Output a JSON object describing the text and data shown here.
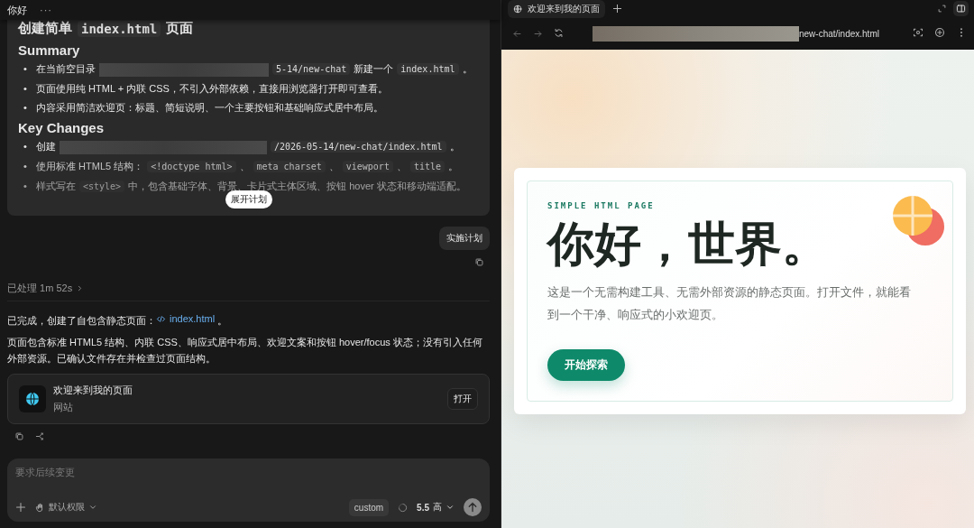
{
  "chat": {
    "title": "你好",
    "menu": "···",
    "plan": {
      "heading": [
        {
          "kind": "text",
          "text": "创建简单"
        },
        {
          "kind": "code",
          "text": "index.html"
        },
        {
          "kind": "text",
          "text": "页面"
        }
      ],
      "marker": "•",
      "sections": [
        {
          "title": "Summary",
          "bullets": [
            [
              {
                "kind": "text",
                "text": "在当前空目录"
              },
              {
                "kind": "redacted"
              },
              {
                "kind": "code",
                "text": "5-14/new-chat"
              },
              {
                "kind": "text",
                "text": "新建一个"
              },
              {
                "kind": "code",
                "text": "index.html"
              },
              {
                "kind": "text",
                "text": "。"
              }
            ],
            [
              {
                "kind": "text",
                "text": "页面使用纯 HTML + 内联 CSS，不引入外部依赖，直接用浏览器打开即可查看。"
              }
            ],
            [
              {
                "kind": "text",
                "text": "内容采用简洁欢迎页：标题、简短说明、一个主要按钮和基础响应式居中布局。"
              }
            ]
          ]
        },
        {
          "title": "Key Changes",
          "bullets": [
            [
              {
                "kind": "text",
                "text": "创建"
              },
              {
                "kind": "redacted"
              },
              {
                "kind": "code",
                "text": "/2026-05-14/new-chat/index.html"
              },
              {
                "kind": "text",
                "text": "。"
              }
            ],
            [
              {
                "kind": "text",
                "text": "使用标准 HTML5 结构："
              },
              {
                "kind": "code",
                "text": "<!doctype html>"
              },
              {
                "kind": "text",
                "text": "、"
              },
              {
                "kind": "code",
                "text": "meta charset"
              },
              {
                "kind": "text",
                "text": "、"
              },
              {
                "kind": "code",
                "text": "viewport"
              },
              {
                "kind": "text",
                "text": "、"
              },
              {
                "kind": "code",
                "text": "title"
              },
              {
                "kind": "text",
                "text": "。"
              }
            ],
            [
              {
                "kind": "text",
                "text": "样式写在"
              },
              {
                "kind": "code",
                "text": "<style>"
              },
              {
                "kind": "text",
                "text": "中，包含基础字体、背景、卡片式主体区域、按钮 hover 状态和移动端适配。"
              }
            ]
          ]
        }
      ],
      "expand_button": "展开计划"
    },
    "user_message": "实施计划",
    "processed": "已处理 1m 52s",
    "reply": {
      "lead": "已完成，创建了自包含静态页面：",
      "link": "index.html",
      "tail": "。",
      "body": "页面包含标准 HTML5 结构、内联 CSS、响应式居中布局、欢迎文案和按钮 hover/focus 状态；没有引入任何外部资源。已确认文件存在并检查过页面结构。"
    },
    "attachment": {
      "title": "欢迎来到我的页面",
      "subtitle": "网站",
      "button": "打开"
    },
    "composer": {
      "placeholder": "要求后续变更",
      "permission": "默认权限",
      "mode": "custom",
      "model": "5.5",
      "effort": "高"
    }
  },
  "browser": {
    "tab": "欢迎来到我的页面",
    "url": "new-chat/index.html",
    "page": {
      "eyebrow": "SIMPLE HTML PAGE",
      "title": "你好，世界。",
      "description": "这是一个无需构建工具、无需外部资源的静态页面。打开文件，就能看到一个干净、响应式的小欢迎页。",
      "button": "开始探索"
    }
  }
}
